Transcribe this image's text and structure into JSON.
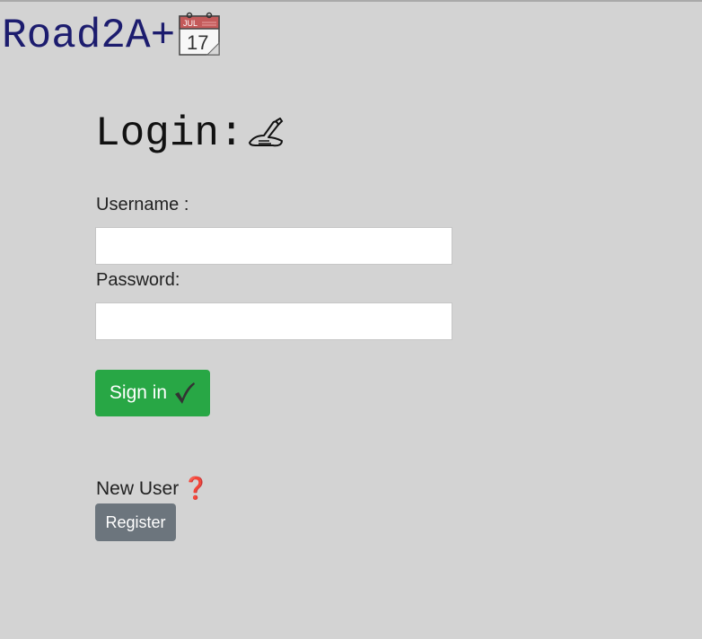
{
  "brand": {
    "title": "Road2A+",
    "icon": "calendar-icon",
    "calendar_month": "JUL",
    "calendar_day": "17",
    "color": "#1c1c6e"
  },
  "login": {
    "title": "Login:",
    "icon": "writing-hand-icon"
  },
  "form": {
    "username_label": "Username :",
    "username_value": "",
    "password_label": "Password:",
    "password_value": "",
    "signin_label": "Sign in",
    "signin_icon": "check-mark-icon",
    "signin_color": "#28a745"
  },
  "register": {
    "prompt": "New User",
    "prompt_icon": "question-mark-icon",
    "button_label": "Register",
    "button_color": "#6c757d"
  },
  "colors": {
    "background": "#d3d3d3"
  }
}
